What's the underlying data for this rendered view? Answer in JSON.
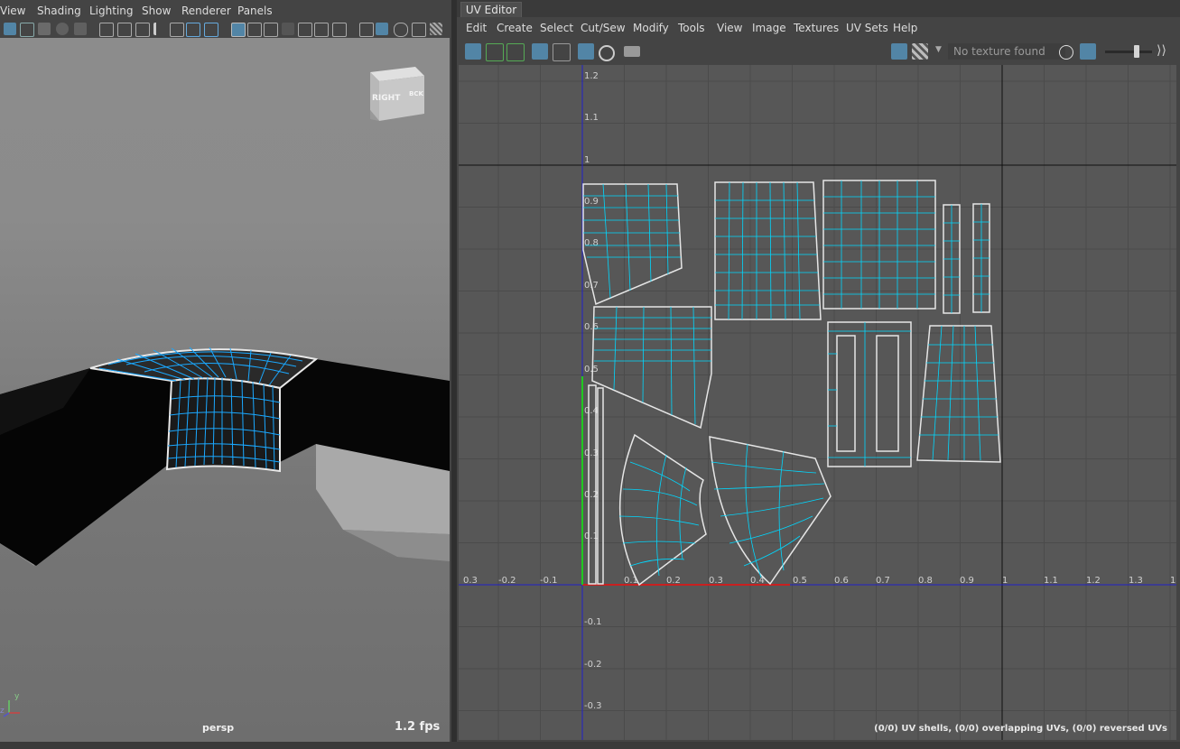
{
  "viewport": {
    "menu": [
      "View",
      "Shading",
      "Lighting",
      "Show",
      "Renderer",
      "Panels"
    ],
    "viewcube_face_front": "RIGHT",
    "viewcube_face_side": "BCK",
    "camera_label": "persp",
    "fps_label": "1.2 fps",
    "axis_labels": {
      "x": "x",
      "y": "y",
      "z": "z"
    },
    "toolbar_icons": [
      "select-icon",
      "lasso-icon",
      "paint-icon",
      "camera-icon",
      "bookmark-icon",
      "grid-icon",
      "shaded-icon",
      "wireframe-icon",
      "texture-icon",
      "light-icon",
      "xray-icon",
      "isolate-icon"
    ]
  },
  "uv_editor": {
    "tab_label": "UV Editor",
    "menu": [
      "Edit",
      "Create",
      "Select",
      "Cut/Sew",
      "Modify",
      "Tools",
      "View",
      "Image",
      "Textures",
      "UV Sets",
      "Help"
    ],
    "texture_field_placeholder": "No texture found",
    "toolbar_icons": [
      "uv-select-icon",
      "uv-transform-icon",
      "uv-move-icon",
      "uv-shell-icon",
      "uv-grid-icon",
      "uv-checker-icon",
      "uv-distortion-icon",
      "uv-snapshot-icon",
      "image-display-icon",
      "checker-display-icon",
      "exposure-icon",
      "gamma-icon"
    ],
    "status": "(0/0) UV shells, (0/0) overlapping UVs, (0/0) reversed UVs",
    "x_ticks": [
      "0.3",
      "-0.2",
      "-0.1",
      "0.1",
      "0.2",
      "0.3",
      "0.4",
      "0.5",
      "0.6",
      "0.7",
      "0.8",
      "0.9",
      "1",
      "1.1",
      "1.2",
      "1.3",
      "1"
    ],
    "y_ticks": [
      "1.2",
      "1.1",
      "1",
      "0.9",
      "0.8",
      "0.7",
      "0.6",
      "0.5",
      "0.4",
      "0.3",
      "0.2",
      "0.1",
      "-0.1",
      "-0.2",
      "-0.3"
    ]
  },
  "colors": {
    "uv_edge": "#00d8ff",
    "uv_border": "#e6e6e6",
    "axis_u": "#2020c8",
    "highlight": "#5285a6"
  }
}
